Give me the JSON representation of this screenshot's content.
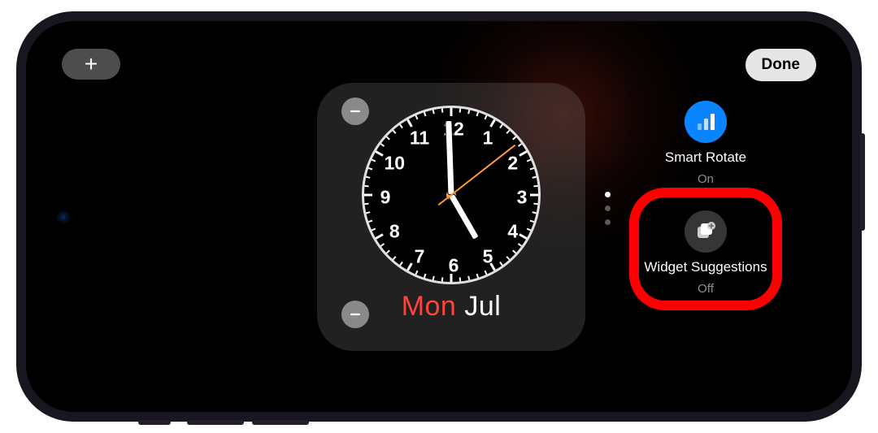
{
  "toolbar": {
    "add_label": "+",
    "done_label": "Done"
  },
  "clock": {
    "numbers": [
      "12",
      "1",
      "2",
      "3",
      "4",
      "5",
      "6",
      "7",
      "8",
      "9",
      "10",
      "11"
    ],
    "hour_angle": 150,
    "minute_angle": 358,
    "second_angle": 52
  },
  "date": {
    "day": "Mon",
    "month": "Jul"
  },
  "page_indicator": {
    "count": 3,
    "active": 0
  },
  "options": {
    "smart_rotate": {
      "label": "Smart Rotate",
      "status": "On",
      "icon": "bars-icon",
      "color": "blue"
    },
    "widget_suggestions": {
      "label": "Widget Suggestions",
      "status": "Off",
      "icon": "stack-plus-icon",
      "color": "grey"
    }
  }
}
